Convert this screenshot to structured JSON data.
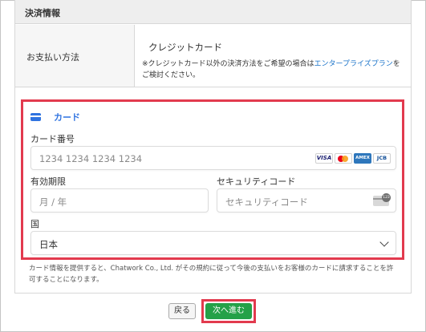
{
  "section": {
    "title": "決済情報"
  },
  "payment_method": {
    "label": "お支払い方法",
    "value": "クレジットカード",
    "note_prefix": "※クレジットカード以外の決済方法をご希望の場合は",
    "note_link": "エンタープライズプラン",
    "note_suffix": "をご検討ください。"
  },
  "card_form": {
    "tab_label": "カード",
    "card_number": {
      "label": "カード番号",
      "placeholder": "1234 1234 1234 1234"
    },
    "brands": [
      "VISA",
      "Mastercard",
      "AMEX",
      "JCB"
    ],
    "expiry": {
      "label": "有効期限",
      "placeholder": "月 / 年"
    },
    "cvc": {
      "label": "セキュリティコード",
      "placeholder": "セキュリティコード"
    },
    "country": {
      "label": "国",
      "value": "日本"
    }
  },
  "consent_text": "カード情報を提供すると、Chatwork Co., Ltd. がその規約に従って今後の支払いをお客様のカードに請求することを許可することになります。",
  "buttons": {
    "back": "戻る",
    "next": "次へ進む"
  },
  "colors": {
    "highlight": "#e23a4e",
    "accent": "#2f73e0",
    "primary_button": "#24a148",
    "link": "#1a73c9"
  }
}
